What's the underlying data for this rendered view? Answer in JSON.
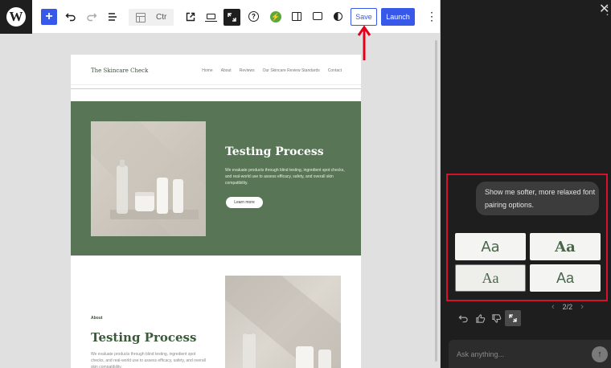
{
  "toolbar": {
    "logo_letter": "W",
    "add_icon": "plus-icon",
    "undo_icon": "undo-icon",
    "redo_icon": "redo-icon",
    "list_view_icon": "list-view-icon",
    "doc_title": "Ctr",
    "external_icon": "external-link-icon",
    "device_icon": "laptop-icon",
    "fullscreen_icon": "fullscreen-icon",
    "help_icon": "help-icon",
    "help_glyph": "?",
    "bolt_icon": "bolt-icon",
    "bolt_glyph": "⚡",
    "sidebar_icon": "sidebar-icon",
    "comment_icon": "comment-icon",
    "contrast_icon": "contrast-icon",
    "save_label": "Save",
    "launch_label": "Launch",
    "more_glyph": "⋮",
    "accent_color": "#3858e9"
  },
  "site": {
    "title": "The Skincare Check",
    "nav": [
      "Home",
      "About",
      "Reviews",
      "Our Skincare Review Standards",
      "Contact"
    ],
    "hero": {
      "title": "Testing Process",
      "text": "We evaluate products through blind testing, ingredient spot checks, and real-world use to assess efficacy, safety, and overall skin compatibility.",
      "button": "Learn more",
      "bg_color": "#587655"
    },
    "about": {
      "label": "About",
      "title": "Testing Process",
      "text": "We evaluate products through blind testing, ingredient spot checks, and real-world use to assess efficacy, safety, and overall skin compatibility."
    }
  },
  "panel": {
    "more_glyph": "⋮",
    "close_glyph": "✕",
    "user_message": "Show me softer, more relaxed font pairing options.",
    "font_options": [
      "Aa",
      "Aa",
      "Aa",
      "Aa"
    ],
    "selected_option_index": 2,
    "pager_prev": "‹",
    "pager_label": "2/2",
    "pager_next": "›",
    "feedback_icons": [
      "undo-icon",
      "thumbs-up-icon",
      "thumbs-down-icon",
      "expand-icon"
    ],
    "ask_placeholder": "Ask anything...",
    "send_glyph": "↑",
    "highlight_color": "#d6112c"
  }
}
